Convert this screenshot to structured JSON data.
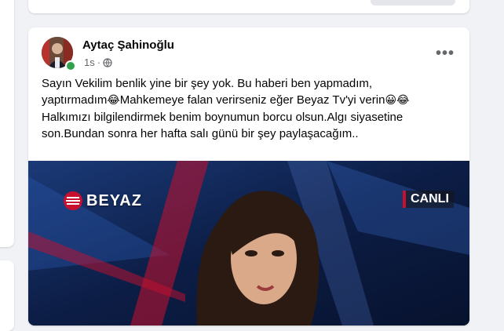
{
  "post": {
    "author": "Aytaç Şahinoğlu",
    "time": "1s",
    "privacy_icon": "globe-icon",
    "more_icon": "more-options-icon",
    "text_lines": [
      "Sayın Vekilim benlik yine bir şey yok. Bu haberi ben yapmadım,",
      "yaptırmadım",
      "Mahkemeye falan verirseniz eğer Beyaz Tv'yi verin",
      "Halkımızı bilgilendirmek benim boynumun borcu olsun.Algı siyasetine",
      "son.Bundan sonra her hafta salı günü bir şey paylaşacağım.."
    ],
    "emoji_laugh": "😂",
    "emoji_grin": "😀",
    "media": {
      "logo_text": "BEYAZ",
      "live_badge": "CANLI"
    }
  },
  "colors": {
    "online": "#31a24c",
    "live_accent": "#c8102e"
  }
}
